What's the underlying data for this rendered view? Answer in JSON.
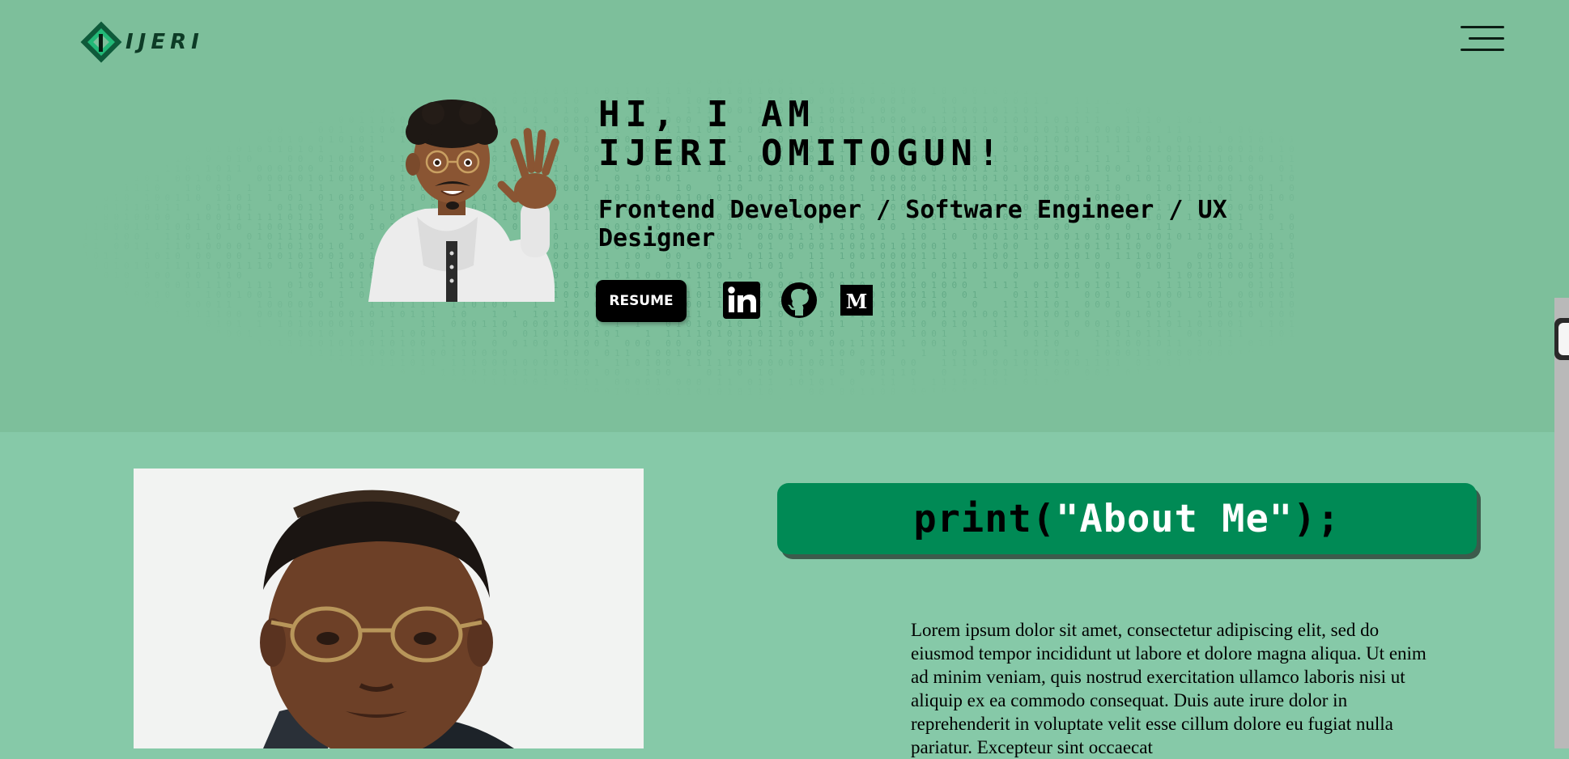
{
  "nav": {
    "logo_text": "IJERI",
    "menu_icon": "hamburger-menu-icon"
  },
  "hero": {
    "title_line1": "HI, I AM",
    "title_line2": "IJERI OMITOGUN!",
    "subtitle": "Frontend Developer / Software Engineer / UX Designer",
    "resume_label": "RESUME",
    "socials": [
      {
        "icon": "linkedin-icon"
      },
      {
        "icon": "github-icon"
      },
      {
        "icon": "medium-icon"
      }
    ]
  },
  "about": {
    "heading_prefix": "print(",
    "heading_string": "\"About Me\"",
    "heading_suffix": ");",
    "text": "Lorem ipsum dolor sit amet, consectetur adipiscing elit, sed do eiusmod tempor incididunt ut labore et dolore magna aliqua. Ut enim ad minim veniam, quis nostrud exercitation ullamco laboris nisi ut aliquip ex ea commodo consequat. Duis aute irure dolor in reprehenderit in voluptate velit esse cillum dolore eu fugiat nulla pariatur. Excepteur sint occaecat"
  },
  "colors": {
    "hero_bg": "#7dbf9b",
    "section_bg": "#86c9a8",
    "accent": "#008a55"
  }
}
